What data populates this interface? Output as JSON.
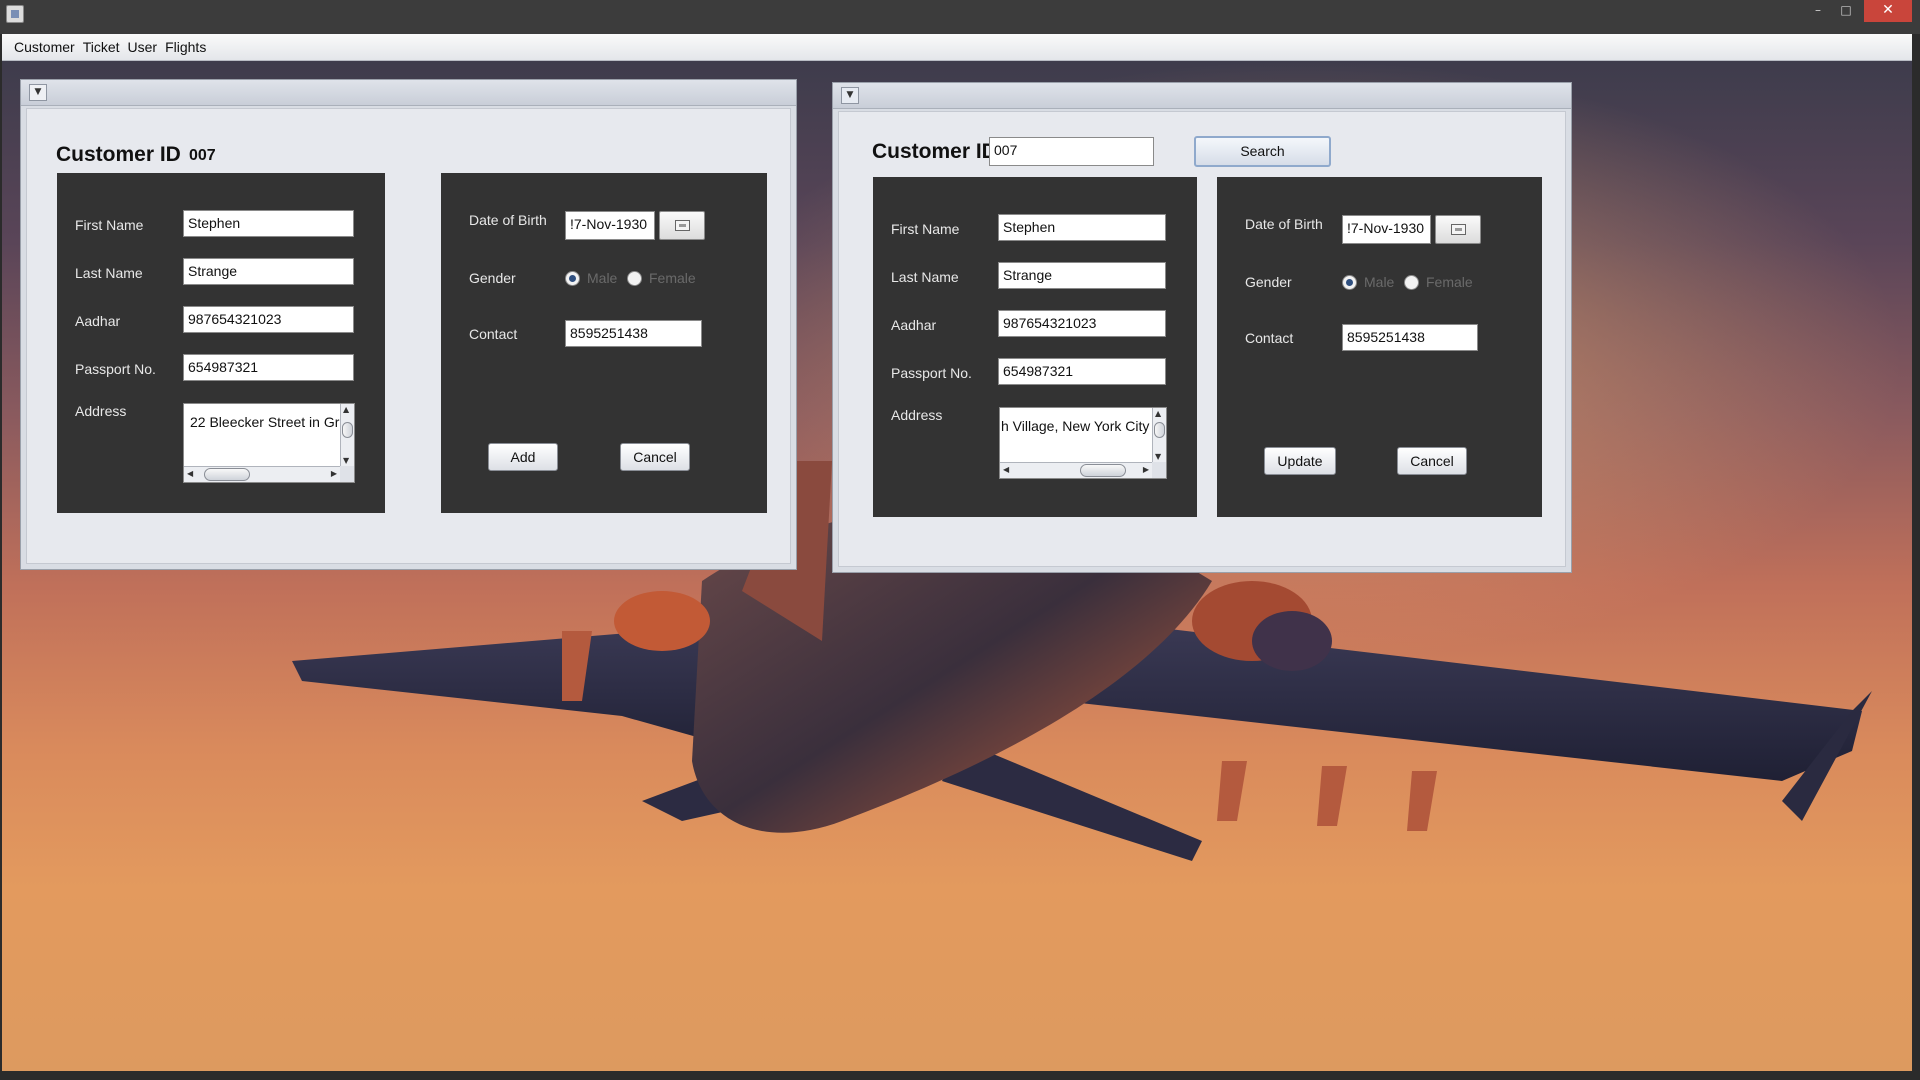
{
  "window": {
    "minimize_glyph": "–",
    "maximize_glyph": "□",
    "close_glyph": "✕"
  },
  "menubar": {
    "items": [
      "Customer",
      "Ticket",
      "User",
      "Flights"
    ]
  },
  "add_form": {
    "heading": "Customer ID",
    "customer_id": "007",
    "first_name_label": "First Name",
    "first_name": "Stephen",
    "last_name_label": "Last Name",
    "last_name": "Strange",
    "aadhar_label": "Aadhar",
    "aadhar": "987654321023",
    "passport_label": "Passport No.",
    "passport": "654987321",
    "address_label": "Address",
    "address_visible": "22 Bleecker Street in Gr",
    "dob_label": "Date of Birth",
    "dob": "!7-Nov-1930",
    "gender_label": "Gender",
    "gender_options": [
      "Male",
      "Female"
    ],
    "gender_selected": "Male",
    "contact_label": "Contact",
    "contact": "8595251438",
    "add_button": "Add",
    "cancel_button": "Cancel"
  },
  "update_form": {
    "heading": "Customer ID",
    "customer_id": "007",
    "search_button": "Search",
    "first_name_label": "First Name",
    "first_name": "Stephen",
    "last_name_label": "Last Name",
    "last_name": "Strange",
    "aadhar_label": "Aadhar",
    "aadhar": "987654321023",
    "passport_label": "Passport No.",
    "passport": "654987321",
    "address_label": "Address",
    "address_visible": "h Village, New York City",
    "dob_label": "Date of Birth",
    "dob": "!7-Nov-1930",
    "gender_label": "Gender",
    "gender_options": [
      "Male",
      "Female"
    ],
    "gender_selected": "Male",
    "contact_label": "Contact",
    "contact": "8595251438",
    "update_button": "Update",
    "cancel_button": "Cancel"
  },
  "colors": {
    "panel_dark": "#333333",
    "close_button": "#c9453b",
    "sky_top": "#3e3c4c",
    "sky_bottom": "#dd9a5f"
  },
  "icons": [
    "app-icon",
    "frame-menu-icon",
    "calendar-icon"
  ]
}
